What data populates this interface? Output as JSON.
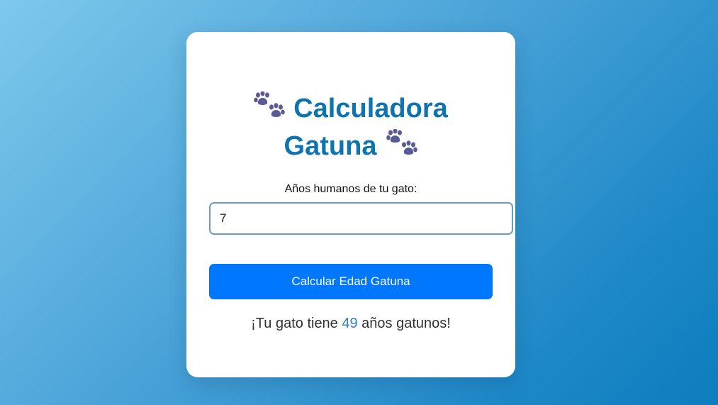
{
  "card": {
    "title_line1": "Calculadora",
    "title_line2": "Gatuna",
    "title_icon": "paw-prints-icon"
  },
  "form": {
    "label": "Años humanos de tu gato:",
    "input_value": "7",
    "button_label": "Calcular Edad Gatuna"
  },
  "result": {
    "prefix": "¡Tu gato tiene ",
    "years": "49",
    "suffix": " años gatunos!"
  },
  "colors": {
    "title": "#0d74b0",
    "paw": "#5a5a96",
    "button": "#0077ff",
    "result_number": "#2e7fd6",
    "input_border": "#6a9cc0"
  }
}
